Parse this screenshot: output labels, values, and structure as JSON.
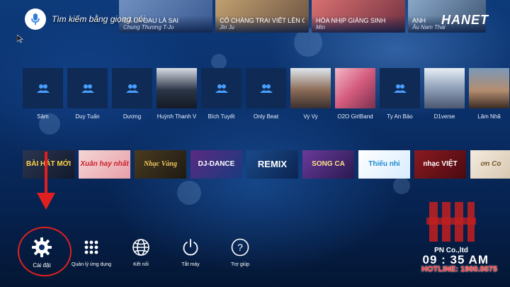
{
  "voice_search": {
    "label": "Tìm kiếm bằng giọng nói"
  },
  "brand": {
    "logo_text": "HANET"
  },
  "songs": [
    {
      "title": "ĐÃ LÀ ĐAU LÀ SAI",
      "artist": "Chung Thương T-Jo"
    },
    {
      "title": "CÔ CHÀNG TRAI VIẾT LÊN CÂY",
      "artist": "Jin Ju"
    },
    {
      "title": "HÒA NHỊP GIÁNG SINH",
      "artist": "Min"
    },
    {
      "title": "ANH",
      "artist": "Âu Nam Thái"
    }
  ],
  "artists": [
    {
      "name": "Sâm"
    },
    {
      "name": "Duy Tuấn"
    },
    {
      "name": "Dương"
    },
    {
      "name": "Huỳnh Thanh V"
    },
    {
      "name": "Bích Tuyết"
    },
    {
      "name": "Only Beat"
    },
    {
      "name": "Vy Vy"
    },
    {
      "name": "O2O GirlBand"
    },
    {
      "name": "Ty An Bảo"
    },
    {
      "name": "D1verse"
    },
    {
      "name": "Lâm Nhã"
    }
  ],
  "playlists": [
    {
      "label": "BÀI HÁT MỚI"
    },
    {
      "label": "Xuân hay nhất"
    },
    {
      "label": "Nhạc Vàng"
    },
    {
      "label": "DJ-DANCE"
    },
    {
      "label": "REMIX"
    },
    {
      "label": "SONG CA"
    },
    {
      "label": "Thiếu nhi"
    },
    {
      "label": "nhạc VIỆT"
    },
    {
      "label": "ơn Co"
    }
  ],
  "menu": {
    "settings": "Cài đặt",
    "apps": "Quản lý ứng dụng",
    "network": "Kết nối",
    "power": "Tắt máy",
    "help": "Trợ giúp"
  },
  "watermark": {
    "company": "PN Co.,ltd",
    "clock": "09 : 35 AM",
    "hotline": "HOTLINE: 1900.0075"
  },
  "colors": {
    "accent_red": "#e02020",
    "background": "#0a2f68"
  }
}
